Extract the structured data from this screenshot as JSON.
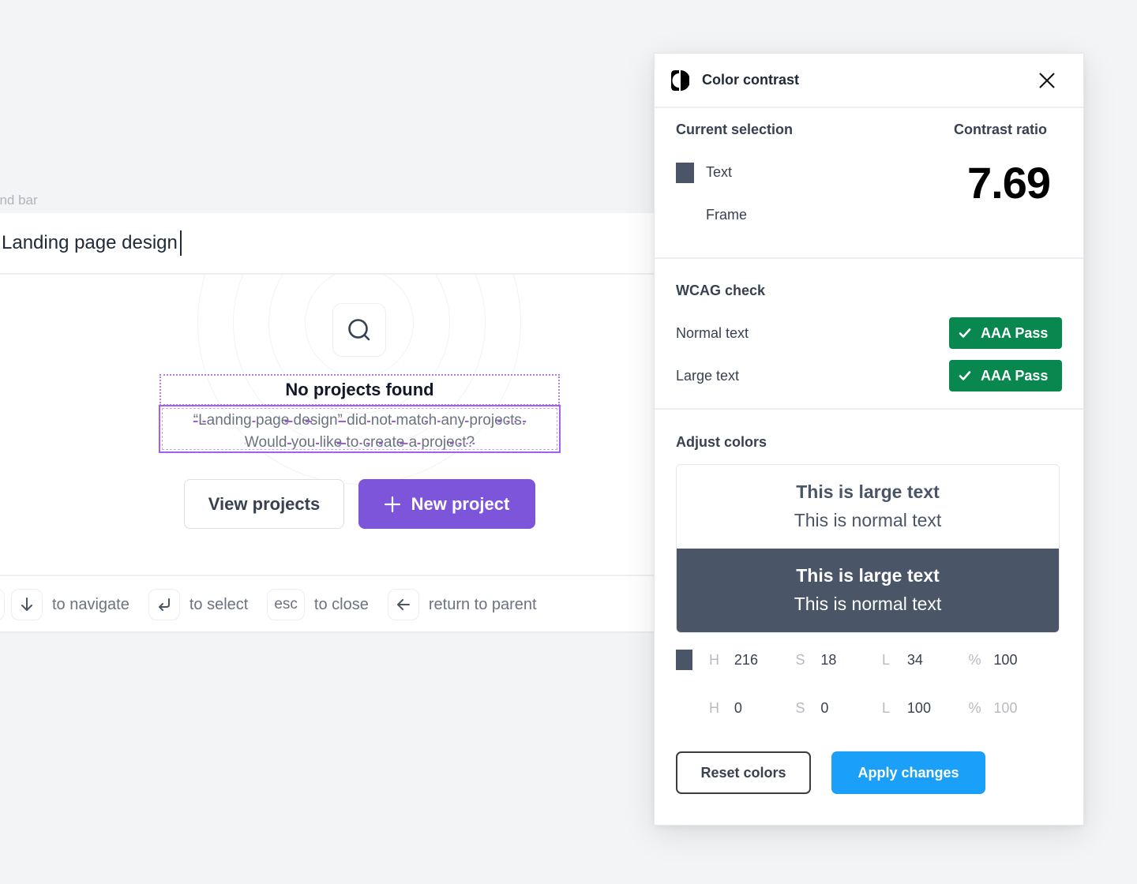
{
  "command_bar": {
    "label": "and bar",
    "search_value": "Landing page design",
    "empty_state": {
      "icon": "search-icon",
      "title": "No projects found",
      "description_line1": "“Landing page design” did not match any projects.",
      "description_line2": "Would you like to create a project?"
    },
    "buttons": {
      "view_projects": "View projects",
      "new_project": "New project"
    },
    "keyboard_hints": [
      {
        "key_icon": "arrow-down-icon",
        "key": "↓",
        "label": "to navigate"
      },
      {
        "key_icon": "enter-icon",
        "key": "↵",
        "label": "to select"
      },
      {
        "key_icon": null,
        "key": "esc",
        "label": "to close"
      },
      {
        "key_icon": "arrow-left-icon",
        "key": "←",
        "label": "return to parent"
      }
    ]
  },
  "contrast_panel": {
    "title": "Color contrast",
    "logo_icon": "half-circle-contrast-icon",
    "close_icon": "close-icon",
    "current_selection": {
      "label": "Current selection",
      "items": [
        {
          "name": "Text",
          "color": "#4a5568"
        },
        {
          "name": "Frame",
          "color": "#ffffff"
        }
      ]
    },
    "contrast_ratio": {
      "label": "Contrast ratio",
      "value": "7.69"
    },
    "wcag": {
      "label": "WCAG check",
      "rows": [
        {
          "label": "Normal text",
          "result": "AAA Pass"
        },
        {
          "label": "Large text",
          "result": "AAA Pass"
        }
      ],
      "pass_color": "#08874f"
    },
    "adjust": {
      "label": "Adjust colors",
      "preview": {
        "large_text": "This is large text",
        "normal_text": "This is normal text"
      },
      "colors": [
        {
          "swatch": "#4a5568",
          "h_key": "H",
          "h": "216",
          "s_key": "S",
          "s": "18",
          "l_key": "L",
          "l": "34",
          "a_key": "%",
          "a": "100"
        },
        {
          "swatch": "#ffffff",
          "h_key": "H",
          "h": "0",
          "s_key": "S",
          "s": "0",
          "l_key": "L",
          "l": "100",
          "a_key": "%",
          "a": "100"
        }
      ]
    },
    "buttons": {
      "reset": "Reset colors",
      "apply": "Apply changes"
    },
    "accent_color": "#1aa0f8"
  }
}
